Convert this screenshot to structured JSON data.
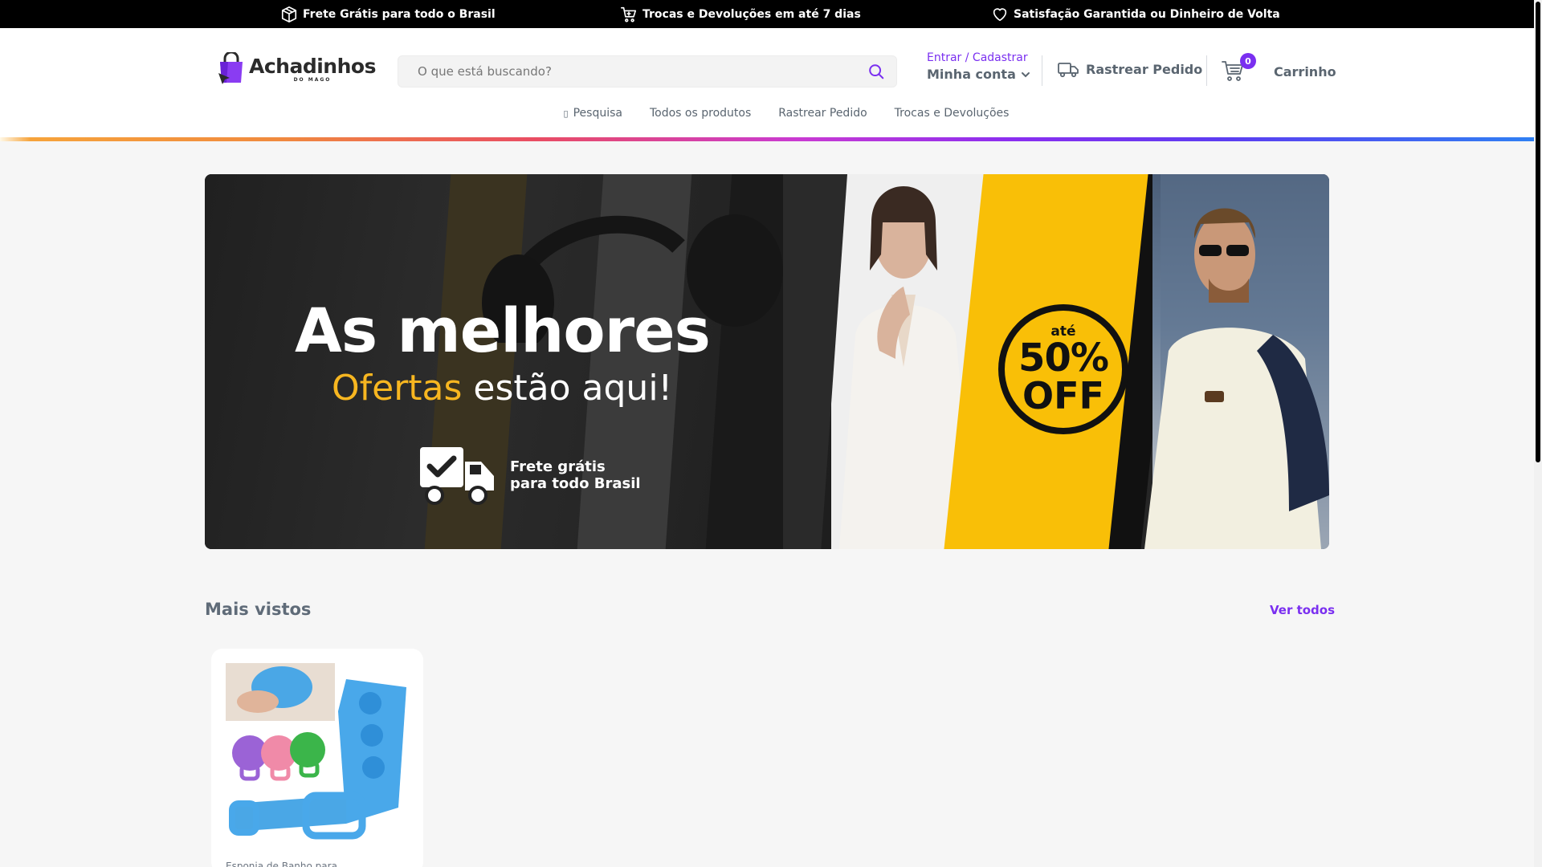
{
  "topbar": {
    "items": [
      {
        "icon": "box-icon",
        "text": "Frete Grátis para todo o Brasil"
      },
      {
        "icon": "cart-icon",
        "text": "Trocas e Devoluções em até 7 dias"
      },
      {
        "icon": "heart-icon",
        "text": "Satisfação Garantida ou Dinheiro de Volta"
      }
    ]
  },
  "brand": {
    "name": "Achadinhos",
    "sub": "DO MAGO",
    "accent": "#7a2ff0"
  },
  "search": {
    "placeholder": "O que está buscando?",
    "value": ""
  },
  "account": {
    "login_label": "Entrar / Cadastrar",
    "my_account_label": "Minha conta"
  },
  "track_order": {
    "label": "Rastrear Pedido"
  },
  "cart": {
    "count": "0",
    "label": "Carrinho"
  },
  "nav": {
    "items": [
      {
        "label": "Pesquisa",
        "icon": "search-icon"
      },
      {
        "label": "Todos os produtos"
      },
      {
        "label": "Rastrear Pedido"
      },
      {
        "label": "Trocas e Devoluções"
      }
    ]
  },
  "banner": {
    "headline": "As melhores",
    "subline_accent": "Ofertas",
    "subline_rest": "estão aqui!",
    "shipping_line1": "Frete grátis",
    "shipping_line2": "para todo Brasil",
    "badge_top": "até",
    "badge_pct": "50%",
    "badge_off": "OFF"
  },
  "section": {
    "title": "Mais vistos",
    "see_all": "Ver todos"
  },
  "products": [
    {
      "name": "Esponja de Banho para"
    }
  ]
}
